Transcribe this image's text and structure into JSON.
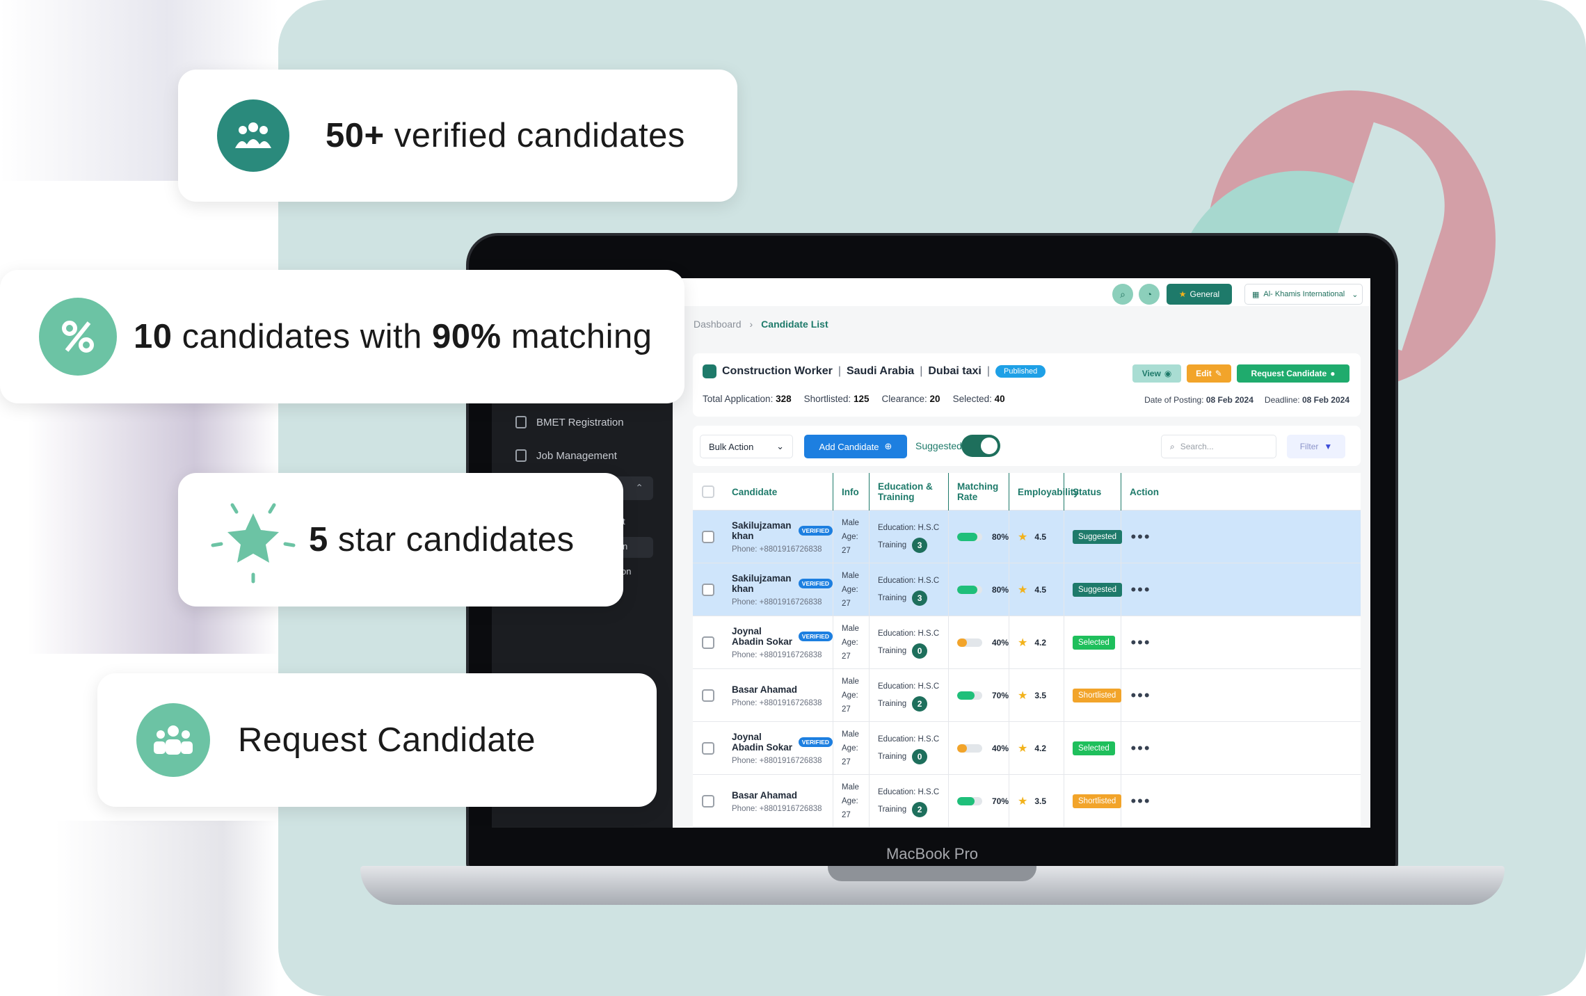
{
  "cards": {
    "verified": {
      "number": "50+",
      "text": " verified candidates"
    },
    "matching": {
      "n1": "10",
      "t1": " candidates with ",
      "n2": "90%",
      "t2": " matching"
    },
    "stars": {
      "number": "5",
      "text": " star candidates"
    },
    "request": {
      "text": "Request Candidate"
    }
  },
  "laptop": {
    "label": "MacBook Pro"
  },
  "sidebar": {
    "items": [
      {
        "label": "BMET Registration",
        "icon": "document-icon"
      },
      {
        "label": "Job Management",
        "icon": "calendar-icon"
      }
    ],
    "fragments": [
      "t",
      "n",
      "on"
    ]
  },
  "topbar": {
    "general_label": "General",
    "org_label": "Al- Khamis International"
  },
  "breadcrumb": {
    "root": "Dashboard",
    "current": "Candidate List"
  },
  "job": {
    "title": "Construction Worker",
    "country": "Saudi Arabia",
    "company": "Dubai taxi",
    "badge": "Published",
    "stats": [
      {
        "label": "Total Application:",
        "value": "328"
      },
      {
        "label": "Shortlisted:",
        "value": "125"
      },
      {
        "label": "Clearance:",
        "value": "20"
      },
      {
        "label": "Selected:",
        "value": "40"
      }
    ],
    "posting_label": "Date of Posting:",
    "posting_date": "08 Feb 2024",
    "deadline_label": "Deadline:",
    "deadline_date": "08 Feb 2024",
    "actions": {
      "view": "View",
      "edit": "Edit",
      "request": "Request Candidate"
    }
  },
  "toolbar": {
    "bulk_action": "Bulk Action",
    "add_candidate": "Add Candidate",
    "suggested_label": "Suggested",
    "suggested_on": true,
    "search_placeholder": "Search...",
    "filter": "Filter"
  },
  "table": {
    "columns": [
      "Candidate",
      "Info",
      "Education & Training",
      "Matching Rate",
      "Employability",
      "Status",
      "Action"
    ],
    "rows": [
      {
        "name": "Sakilujzaman khan",
        "verified": true,
        "verified_label": "VERIFIED",
        "phone": "Phone: +8801916726838",
        "gender": "Male",
        "age": "Age: 27",
        "education": "Education: H.S.C",
        "training_label": "Training",
        "training": "3",
        "match": "80%",
        "match_value": 80,
        "match_color": "#1fbf7a",
        "rating": "4.5",
        "status": "Suggested",
        "status_color": "#1e7a6a",
        "highlight": true
      },
      {
        "name": "Sakilujzaman khan",
        "verified": true,
        "verified_label": "VERIFIED",
        "phone": "Phone: +8801916726838",
        "gender": "Male",
        "age": "Age: 27",
        "education": "Education: H.S.C",
        "training_label": "Training",
        "training": "3",
        "match": "80%",
        "match_value": 80,
        "match_color": "#1fbf7a",
        "rating": "4.5",
        "status": "Suggested",
        "status_color": "#1e7a6a",
        "highlight": true
      },
      {
        "name": "Joynal Abadin Sokar",
        "verified": true,
        "verified_label": "VERIFIED",
        "phone": "Phone: +8801916726838",
        "gender": "Male",
        "age": "Age: 27",
        "education": "Education: H.S.C",
        "training_label": "Training",
        "training": "0",
        "match": "40%",
        "match_value": 40,
        "match_color": "#f2a42a",
        "rating": "4.2",
        "status": "Selected",
        "status_color": "#1fbf5c",
        "highlight": false
      },
      {
        "name": "Basar Ahamad",
        "verified": false,
        "verified_label": "",
        "phone": "Phone: +8801916726838",
        "gender": "Male",
        "age": "Age: 27",
        "education": "Education: H.S.C",
        "training_label": "Training",
        "training": "2",
        "match": "70%",
        "match_value": 70,
        "match_color": "#1fbf7a",
        "rating": "3.5",
        "status": "Shortlisted",
        "status_color": "#f2a42a",
        "highlight": false
      },
      {
        "name": "Joynal Abadin Sokar",
        "verified": true,
        "verified_label": "VERIFIED",
        "phone": "Phone: +8801916726838",
        "gender": "Male",
        "age": "Age: 27",
        "education": "Education: H.S.C",
        "training_label": "Training",
        "training": "0",
        "match": "40%",
        "match_value": 40,
        "match_color": "#f2a42a",
        "rating": "4.2",
        "status": "Selected",
        "status_color": "#1fbf5c",
        "highlight": false
      },
      {
        "name": "Basar Ahamad",
        "verified": false,
        "verified_label": "",
        "phone": "Phone: +8801916726838",
        "gender": "Male",
        "age": "Age: 27",
        "education": "Education: H.S.C",
        "training_label": "Training",
        "training": "2",
        "match": "70%",
        "match_value": 70,
        "match_color": "#1fbf7a",
        "rating": "3.5",
        "status": "Shortlisted",
        "status_color": "#f2a42a",
        "highlight": false
      }
    ]
  },
  "colors": {
    "brand": "#1e7a6a",
    "card_icon_teal": "#2a8a7c",
    "card_icon_green": "#6cc3a4",
    "star": "#f2b21b"
  }
}
